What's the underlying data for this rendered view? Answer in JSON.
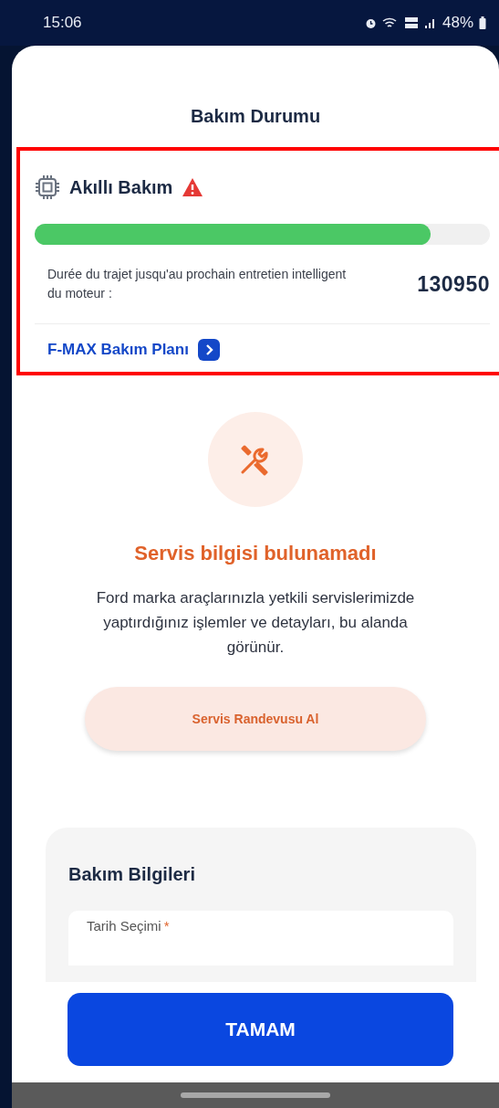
{
  "status_bar": {
    "time": "15:06",
    "battery": "48%"
  },
  "title": "Bakım Durumu",
  "smart_maintenance": {
    "title": "Akıllı Bakım",
    "warning": true,
    "level": 0.87,
    "description": "Durée du trajet jusqu'au prochain entretien intelligent du moteur :",
    "value": "130950",
    "link": "F-MAX Bakım Planı"
  },
  "empty_state": {
    "heading": "Servis bilgisi bulunamadı",
    "message": "Ford marka araçlarınızla yetkili servislerimizde yaptırdığınız işlemler ve detayları, bu alanda görünür.",
    "button": "Servis Randevusu Al"
  },
  "maintenance_info": {
    "title": "Bakım Bilgileri",
    "fields": [
      {
        "label": "Tarih Seçimi",
        "required_mark": "*"
      }
    ]
  },
  "confirm_button": "TAMAM"
}
